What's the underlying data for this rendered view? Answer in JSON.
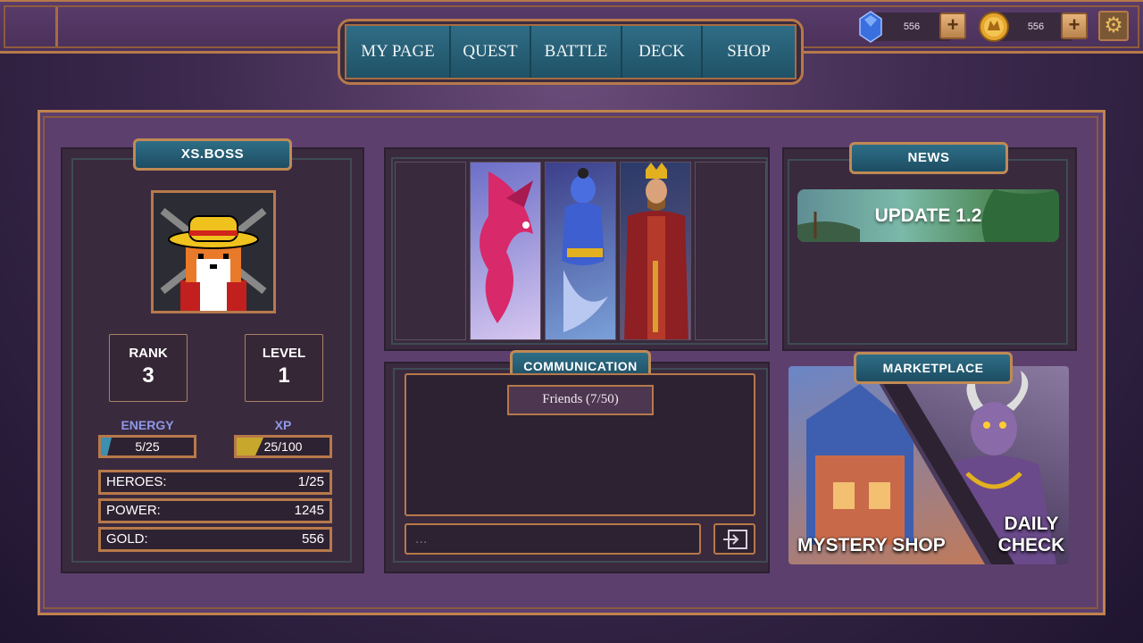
{
  "header": {
    "gems": "556",
    "coins": "556",
    "nav_tabs": [
      "MY PAGE",
      "QUEST",
      "BATTLE",
      "DECK",
      "SHOP"
    ]
  },
  "profile": {
    "name": "XS.BOSS",
    "rank_label": "RANK",
    "rank_value": "3",
    "level_label": "LEVEL",
    "level_value": "1",
    "energy_label": "ENERGY",
    "energy_value": "5/25",
    "energy_fraction": 0.2,
    "xp_label": "XP",
    "xp_value": "25/100",
    "xp_fraction": 0.25,
    "heroes_label": "HEROES:",
    "heroes_value": "1/25",
    "power_label": "POWER:",
    "power_value": "1245",
    "gold_label": "GOLD:",
    "gold_value": "556"
  },
  "communication": {
    "title": "COMMUNICATION",
    "friends_label": "Friends (7/50)",
    "input_placeholder": "..."
  },
  "news": {
    "title": "NEWS",
    "item_title": "UPDATE 1.2"
  },
  "marketplace": {
    "title": "MARKETPLACE",
    "left_label": "MYSTERY SHOP",
    "right_label_1": "DAILY",
    "right_label_2": "CHECK"
  },
  "colors": {
    "accent_frame": "#b7794a",
    "banner_teal": "#2e6e87",
    "panel_bg": "#3a2a3e",
    "energy_fill": "#3d8fb0",
    "xp_fill": "#c7a82c"
  }
}
